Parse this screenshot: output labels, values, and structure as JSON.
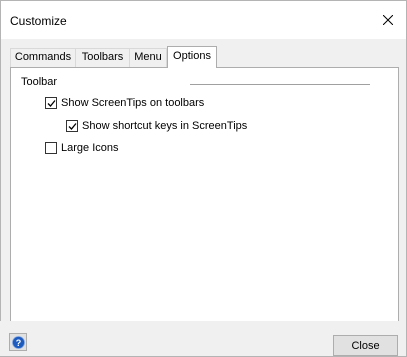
{
  "window": {
    "title": "Customize",
    "close_glyph": "close-x-icon"
  },
  "tabs": [
    {
      "label": "Commands",
      "active": false
    },
    {
      "label": "Toolbars",
      "active": false
    },
    {
      "label": "Menu",
      "active": false
    },
    {
      "label": "Options",
      "active": true
    }
  ],
  "options": {
    "group_label": "Toolbar",
    "checkboxes": [
      {
        "label": "Show ScreenTips on toolbars",
        "checked": true
      },
      {
        "label": "Show shortcut keys in ScreenTips",
        "checked": true
      },
      {
        "label": "Large Icons",
        "checked": false
      }
    ]
  },
  "footer": {
    "help_icon": "help-icon",
    "close_label": "Close"
  },
  "colors": {
    "help_blue": "#1e5bbf",
    "border": "#adadad",
    "dialog_bg": "#f0f0f0"
  }
}
